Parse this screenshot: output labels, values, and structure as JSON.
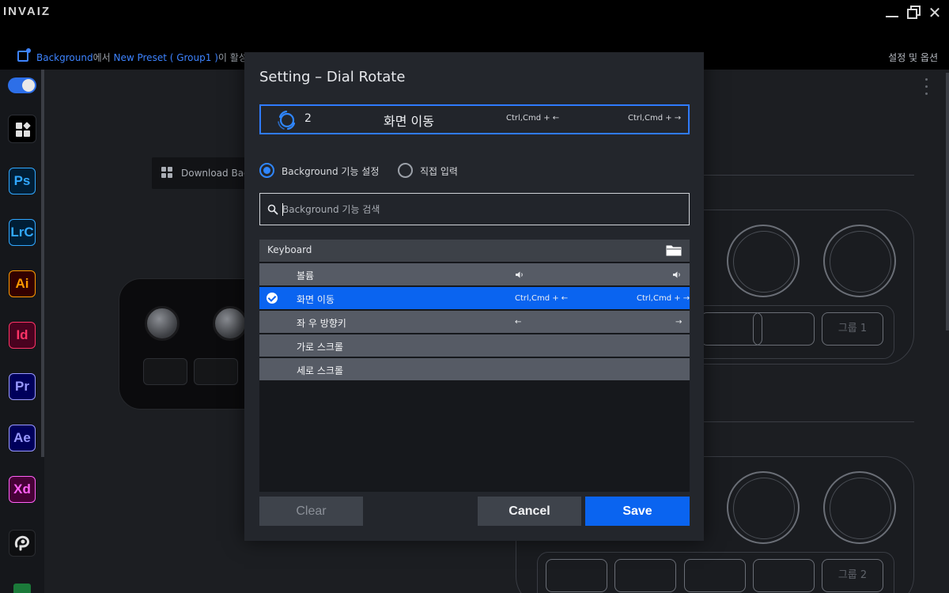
{
  "titlebar": {
    "logo": "INVAIZ",
    "minimize": "minimize",
    "restore": "restore",
    "close": "✕"
  },
  "status": {
    "app": "Background",
    "connector1": "에서 ",
    "preset": "New Preset ( Group1 )",
    "connector2": "이 활성",
    "options": "설정 및 옵션"
  },
  "sidebar": {
    "apps": [
      {
        "label": "Ps",
        "color": "#31a8ff",
        "bg": "#001e36"
      },
      {
        "label": "LrC",
        "color": "#31a8ff",
        "bg": "#001e36"
      },
      {
        "label": "Ai",
        "color": "#ff9a00",
        "bg": "#330000"
      },
      {
        "label": "Id",
        "color": "#ff3366",
        "bg": "#49021f"
      },
      {
        "label": "Pr",
        "color": "#9999ff",
        "bg": "#00005b"
      },
      {
        "label": "Ae",
        "color": "#9999ff",
        "bg": "#00005b"
      },
      {
        "label": "Xd",
        "color": "#ff61f6",
        "bg": "#470137"
      }
    ]
  },
  "content": {
    "download_label": "Download Backg",
    "group1_label": "그룹 1",
    "group2_label": "그룹 2"
  },
  "modal": {
    "title": "Setting – Dial Rotate",
    "selected": {
      "number": "2",
      "name": "화면 이동",
      "shortcut_left": "Ctrl,Cmd + ←",
      "shortcut_right": "Ctrl,Cmd + →"
    },
    "radio_background": "Background 기능 설정",
    "radio_direct": "직접 입력",
    "search_placeholder": "Background 기능 검색",
    "list_header": "Keyboard",
    "rows": [
      {
        "label": "볼륨",
        "left": "🔈",
        "right": "🔈",
        "selected": false
      },
      {
        "label": "화면 이동",
        "left": "Ctrl,Cmd + ←",
        "right": "Ctrl,Cmd + →",
        "selected": true
      },
      {
        "label": "좌 우 방향키",
        "left": "←",
        "right": "→",
        "selected": false
      },
      {
        "label": "가로 스크롤",
        "left": "",
        "right": "",
        "selected": false
      },
      {
        "label": "세로 스크롤",
        "left": "",
        "right": "",
        "selected": false
      }
    ],
    "buttons": {
      "clear": "Clear",
      "cancel": "Cancel",
      "save": "Save"
    }
  },
  "colors": {
    "accent": "#0a64f0",
    "selected_border": "#2f7bff",
    "modal_bg": "#23262c"
  }
}
